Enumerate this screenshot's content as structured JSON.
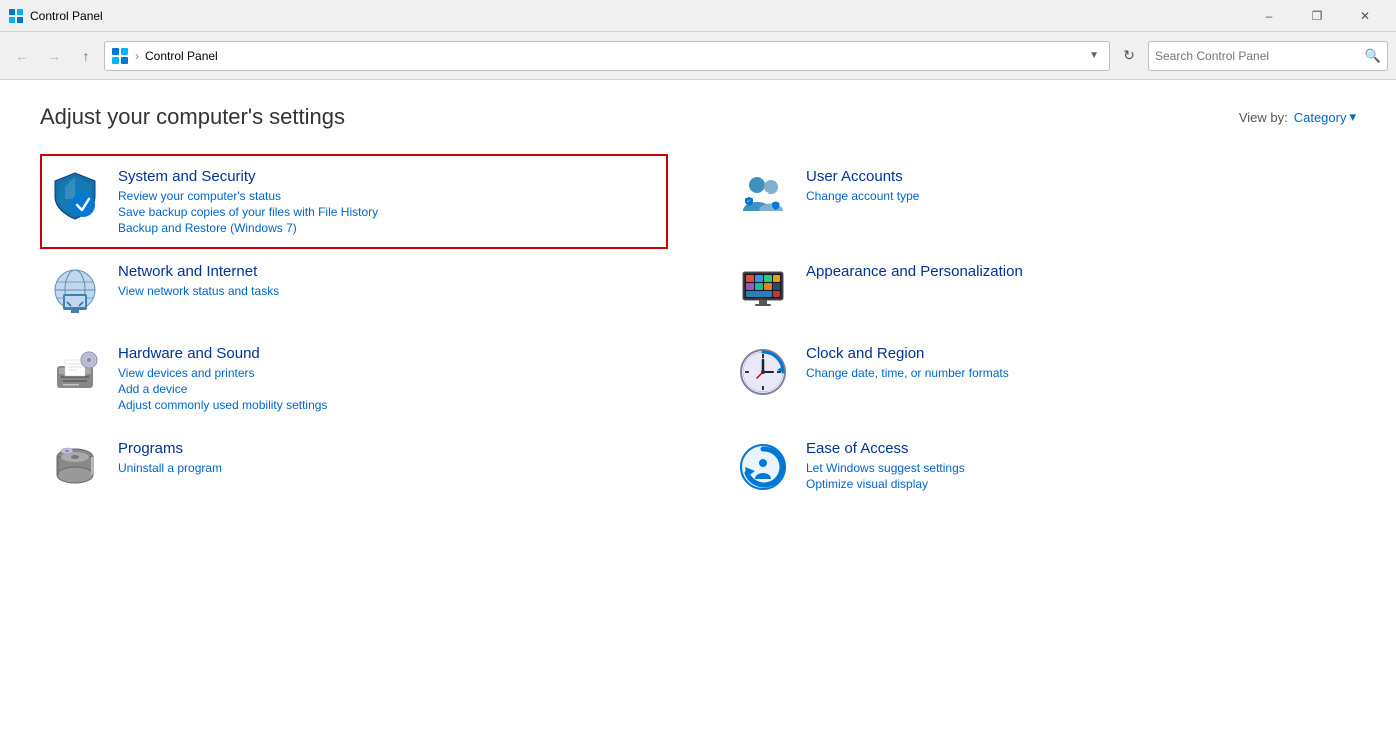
{
  "window": {
    "title": "Control Panel",
    "minimize_label": "–",
    "maximize_label": "❐",
    "close_label": "✕"
  },
  "navbar": {
    "back_tooltip": "Back",
    "forward_tooltip": "Forward",
    "up_tooltip": "Up",
    "address_path": "Control Panel",
    "refresh_tooltip": "Refresh",
    "search_placeholder": "Search Control Panel"
  },
  "page": {
    "title": "Adjust your computer's settings",
    "view_by_label": "View by:",
    "view_by_value": "Category"
  },
  "categories": [
    {
      "id": "system-security",
      "title": "System and Security",
      "highlighted": true,
      "links": [
        "Review your computer's status",
        "Save backup copies of your files with File History",
        "Backup and Restore (Windows 7)"
      ]
    },
    {
      "id": "user-accounts",
      "title": "User Accounts",
      "highlighted": false,
      "links": [
        "Change account type"
      ]
    },
    {
      "id": "network-internet",
      "title": "Network and Internet",
      "highlighted": false,
      "links": [
        "View network status and tasks"
      ]
    },
    {
      "id": "appearance-personalization",
      "title": "Appearance and Personalization",
      "highlighted": false,
      "links": []
    },
    {
      "id": "hardware-sound",
      "title": "Hardware and Sound",
      "highlighted": false,
      "links": [
        "View devices and printers",
        "Add a device",
        "Adjust commonly used mobility settings"
      ]
    },
    {
      "id": "clock-region",
      "title": "Clock and Region",
      "highlighted": false,
      "links": [
        "Change date, time, or number formats"
      ]
    },
    {
      "id": "programs",
      "title": "Programs",
      "highlighted": false,
      "links": [
        "Uninstall a program"
      ]
    },
    {
      "id": "ease-of-access",
      "title": "Ease of Access",
      "highlighted": false,
      "links": [
        "Let Windows suggest settings",
        "Optimize visual display"
      ]
    }
  ]
}
